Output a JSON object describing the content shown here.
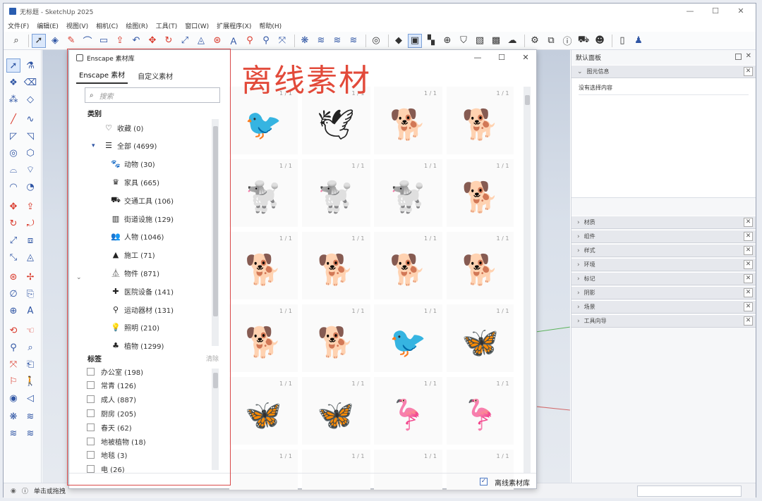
{
  "app": {
    "title": "无标题 - SketchUp 2025",
    "window_controls": [
      "—",
      "☐",
      "✕"
    ],
    "menus": [
      "文件(F)",
      "编辑(E)",
      "视图(V)",
      "相机(C)",
      "绘图(R)",
      "工具(T)",
      "窗口(W)",
      "扩展程序(X)",
      "帮助(H)"
    ]
  },
  "status": {
    "text": "单击或拖拽"
  },
  "default_tray": {
    "title": "默认面板",
    "entity_info": {
      "label": "图元信息",
      "content": "没有选择内容"
    },
    "trays": [
      "材质",
      "组件",
      "样式",
      "环境",
      "标记",
      "阴影",
      "场景",
      "工具向导"
    ],
    "close": "✕"
  },
  "enscape_dialog": {
    "title": "Enscape 素材库",
    "controls": [
      "—",
      "☐",
      "✕"
    ],
    "tabs": [
      "Enscape 素材",
      "自定义素材"
    ],
    "search_placeholder": "搜索",
    "categories_header": "类别",
    "categories": [
      {
        "icon": "♡",
        "label": "收藏 (0)",
        "indent": 1
      },
      {
        "icon": "☰",
        "label": "全部 (4699)",
        "indent": 1,
        "expanded": true
      },
      {
        "icon": "🐾",
        "label": "动物 (30)",
        "indent": 2
      },
      {
        "icon": "♛",
        "label": "家具 (665)",
        "indent": 2
      },
      {
        "icon": "⛟",
        "label": "交通工具 (106)",
        "indent": 2
      },
      {
        "icon": "▥",
        "label": "街道设施 (129)",
        "indent": 2
      },
      {
        "icon": "👥",
        "label": "人物 (1046)",
        "indent": 2
      },
      {
        "icon": "▲",
        "label": "施工 (71)",
        "indent": 2
      },
      {
        "icon": "⏅",
        "label": "物件 (871)",
        "indent": 2
      },
      {
        "icon": "✚",
        "label": "医院设备 (141)",
        "indent": 2
      },
      {
        "icon": "⚲",
        "label": "运动器材 (131)",
        "indent": 2
      },
      {
        "icon": "💡",
        "label": "照明 (210)",
        "indent": 2
      },
      {
        "icon": "♣",
        "label": "植物 (1299)",
        "indent": 2
      }
    ],
    "tags_header": "标签",
    "clear_label": "清除",
    "tags": [
      "办公室 (198)",
      "常青 (126)",
      "成人 (887)",
      "厨房 (205)",
      "春天 (62)",
      "地被植物 (18)",
      "地毯 (3)",
      "电 (26)"
    ],
    "asset_count_label": "1 / 1",
    "assets": [
      {
        "icon": "🐦",
        "name": "pigeon-standing"
      },
      {
        "icon": "🕊",
        "name": "pigeon-flying"
      },
      {
        "icon": "🐕",
        "name": "dog-lying"
      },
      {
        "icon": "🐕",
        "name": "spaniel-sitting"
      },
      {
        "icon": "🐩",
        "name": "poodle-white"
      },
      {
        "icon": "🐩",
        "name": "poodle-pink-shirt"
      },
      {
        "icon": "🐩",
        "name": "poodle-cream"
      },
      {
        "icon": "🐕",
        "name": "dog-sitting"
      },
      {
        "icon": "🐕",
        "name": "beagle-running"
      },
      {
        "icon": "🐕",
        "name": "retriever-walking"
      },
      {
        "icon": "🐕",
        "name": "retriever-sitting"
      },
      {
        "icon": "🐕",
        "name": "retriever-lying"
      },
      {
        "icon": "🐕",
        "name": "labrador-standing"
      },
      {
        "icon": "🐕",
        "name": "dog-sniffing"
      },
      {
        "icon": "🐦",
        "name": "seagull"
      },
      {
        "icon": "🦋",
        "name": "butterfly-blue"
      },
      {
        "icon": "🦋",
        "name": "butterfly-red"
      },
      {
        "icon": "🦋",
        "name": "butterfly-yellow"
      },
      {
        "icon": "🦩",
        "name": "flamingo-standing"
      },
      {
        "icon": "🦩",
        "name": "flamingo-walking"
      },
      {
        "icon": "",
        "name": "asset-partial-1"
      },
      {
        "icon": "",
        "name": "asset-partial-2"
      },
      {
        "icon": "",
        "name": "asset-partial-3"
      },
      {
        "icon": "",
        "name": "asset-partial-4"
      }
    ],
    "offline_checkbox_label": "离线素材库",
    "offline_checked": true
  },
  "annotation": {
    "text": "离线素材",
    "color": "#e24a3a"
  }
}
